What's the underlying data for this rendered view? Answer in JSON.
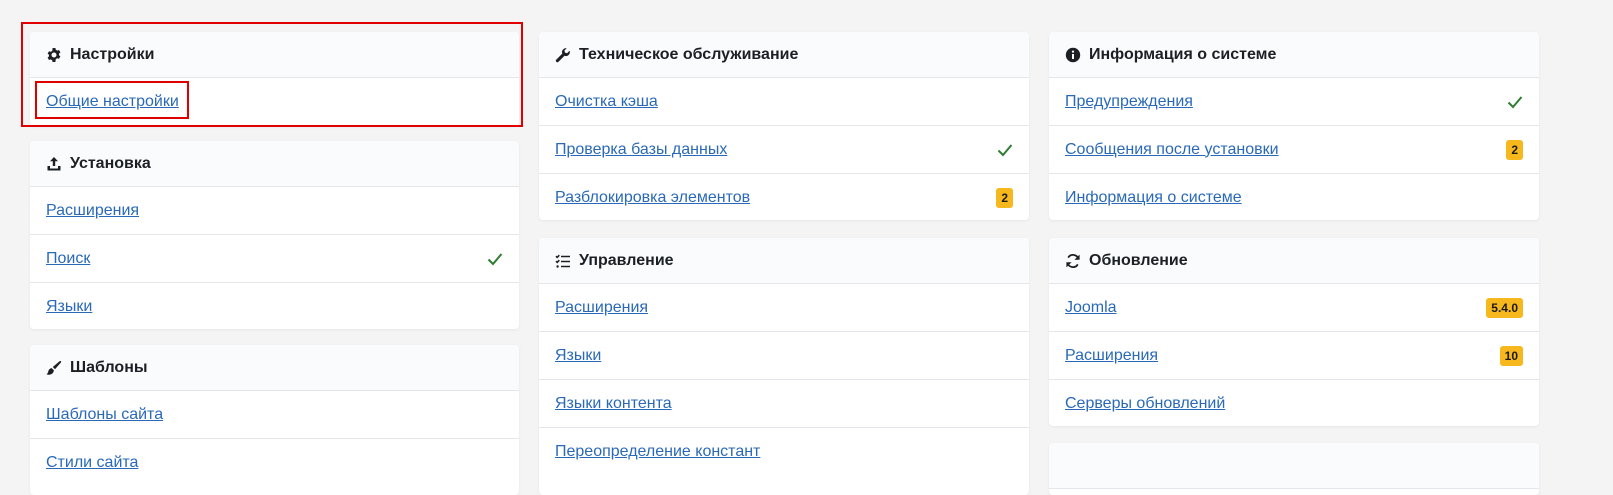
{
  "colors": {
    "accent_link": "#2a69b8",
    "badge": "#f6b81c",
    "check": "#2f7d32",
    "highlight": "#e00000"
  },
  "cards": {
    "settings": {
      "title": "Настройки",
      "icon": "gear-icon",
      "items": [
        {
          "label": "Общие настройки"
        }
      ]
    },
    "install": {
      "title": "Установка",
      "icon": "upload-icon",
      "items": [
        {
          "label": "Расширения"
        },
        {
          "label": "Поиск",
          "status": "check"
        },
        {
          "label": "Языки"
        }
      ]
    },
    "templates": {
      "title": "Шаблоны",
      "icon": "paintbrush-icon",
      "items": [
        {
          "label": "Шаблоны сайта"
        },
        {
          "label": "Стили сайта"
        }
      ]
    },
    "maintenance": {
      "title": "Техническое обслуживание",
      "icon": "wrench-icon",
      "items": [
        {
          "label": "Очистка кэша"
        },
        {
          "label": "Проверка базы данных",
          "status": "check"
        },
        {
          "label": "Разблокировка элементов",
          "badge": "2"
        }
      ]
    },
    "manage": {
      "title": "Управление",
      "icon": "list-check-icon",
      "items": [
        {
          "label": "Расширения"
        },
        {
          "label": "Языки"
        },
        {
          "label": "Языки контента"
        },
        {
          "label": "Переопределение констант"
        }
      ]
    },
    "sysinfo": {
      "title": "Информация о системе",
      "icon": "info-circle-icon",
      "items": [
        {
          "label": "Предупреждения",
          "status": "check"
        },
        {
          "label": "Сообщения после установки",
          "badge": "2"
        },
        {
          "label": "Информация о системе"
        }
      ]
    },
    "update": {
      "title": "Обновление",
      "icon": "sync-icon",
      "items": [
        {
          "label": "Joomla",
          "badge": "5.4.0"
        },
        {
          "label": "Расширения",
          "badge": "10"
        },
        {
          "label": "Серверы обновлений"
        }
      ]
    }
  }
}
